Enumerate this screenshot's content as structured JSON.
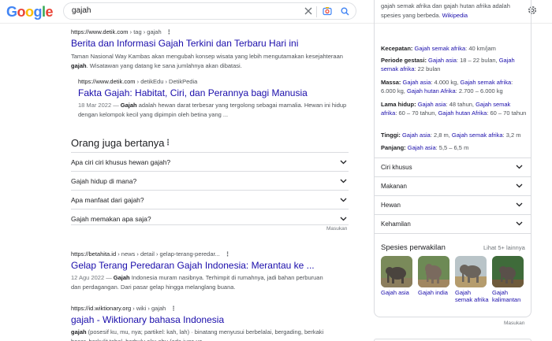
{
  "header": {
    "logo": [
      "G",
      "o",
      "o",
      "g",
      "l",
      "e"
    ],
    "logo_colors": [
      "#4285f4",
      "#ea4335",
      "#fbbc05",
      "#4285f4",
      "#34a853",
      "#ea4335"
    ],
    "query": "gajah"
  },
  "results": [
    {
      "url_domain": "https://www.detik.com",
      "url_path": " › tag › gajah",
      "title": "Berita dan Informasi Gajah Terkini dan Terbaru Hari ini",
      "snippet_pre": "Taman Nasional Way Kambas akan mengubah konsep wisata yang lebih mengutamakan kesejahteraan ",
      "snippet_bold": "gajah",
      "snippet_post": ". Wisatawan yang datang ke sana jumlahnya akan dibatasi."
    },
    {
      "url_domain": "https://www.detik.com",
      "url_path": " › detikEdu › DetikPedia",
      "title": "Fakta Gajah: Habitat, Ciri, dan Perannya bagi Manusia",
      "date": "18 Mar 2022 — ",
      "snippet_bold": "Gajah",
      "snippet_post": " adalah hewan darat terbesar yang tergolong sebagai mamalia. Hewan ini hidup dengan kelompok kecil yang dipimpin oleh betina yang ..."
    },
    {
      "url_domain": "https://betahita.id",
      "url_path": " › news › detail › gelap-terang-peredar...",
      "title": "Gelap Terang Peredaran Gajah Indonesia: Merantau ke ...",
      "date": "12 Agu 2022 — ",
      "snippet_bold": "Gajah",
      "snippet_post": " Indonesia muram nasibnya. Terhimpit di rumahnya, jadi bahan perburuan dan perdagangan. Dari pasar gelap hingga melanglang buana."
    },
    {
      "url_domain": "https://id.wiktionary.org",
      "url_path": " › wiki › gajah",
      "title": "gajah - Wiktionary bahasa Indonesia",
      "snippet_bold": "gajah",
      "snippet_post": " (posesif ku, mu, nya; partikel: kah, lah) · binatang menyusui berbelalai, bergading, berkaki besar, berkulit tebal, berbulu aku abu (ada juga ya..."
    }
  ],
  "paa": {
    "title": "Orang juga bertanya",
    "questions": [
      "Apa ciri ciri khusus hewan gajah?",
      "Gajah hidup di mana?",
      "Apa manfaat dari gajah?",
      "Gajah memakan apa saja?"
    ],
    "feedback": "Masukan"
  },
  "kp": {
    "desc_text": "gajah semak afrika dan gajah hutan afrika adalah spesies yang berbeda.",
    "desc_link": "Wikipedia",
    "facts": {
      "kecepatan_label": "Kecepatan:",
      "kecepatan_link": "Gajah semak afrika",
      "kecepatan_val": ": 40 km/jam",
      "gestasi_label": "Periode gestasi:",
      "gestasi_link1": "Gajah asia",
      "gestasi_val1": ": 18 – 22 bulan,",
      "gestasi_link2": "Gajah semak afrika",
      "gestasi_val2": ": 22 bulan",
      "massa_label": "Massa:",
      "massa_link1": "Gajah asia",
      "massa_val1": ": 4.000 kg,",
      "massa_link2": "Gajah semak afrika",
      "massa_val2": ": 6.000 kg,",
      "massa_link3": "Gajah hutan Afrika",
      "massa_val3": ": 2.700 – 6.000 kg",
      "hidup_label": "Lama hidup:",
      "hidup_link1": "Gajah asia",
      "hidup_val1": ": 48 tahun,",
      "hidup_link2": "Gajah semak afrika",
      "hidup_val2": ": 60 – 70 tahun,",
      "hidup_link3": "Gajah hutan Afrika",
      "hidup_val3": ": 60 – 70 tahun",
      "tinggi_label": "Tinggi:",
      "tinggi_link1": "Gajah asia",
      "tinggi_val1": ": 2,8 m,",
      "tinggi_link2": "Gajah semak afrika",
      "tinggi_val2": ": 3,2 m",
      "panjang_label": "Panjang:",
      "panjang_link": "Gajah asia",
      "panjang_val": ": 5,5 – 6,5 m"
    },
    "sections": [
      "Ciri khusus",
      "Makanan",
      "Hewan",
      "Kehamilan"
    ],
    "species_title": "Spesies perwakilan",
    "species_more": "Lihat 5+ lainnya",
    "species": [
      "Gajah asia",
      "Gajah india",
      "Gajah semak afrika",
      "Gajah kalimantan"
    ],
    "feedback": "Masukan"
  }
}
